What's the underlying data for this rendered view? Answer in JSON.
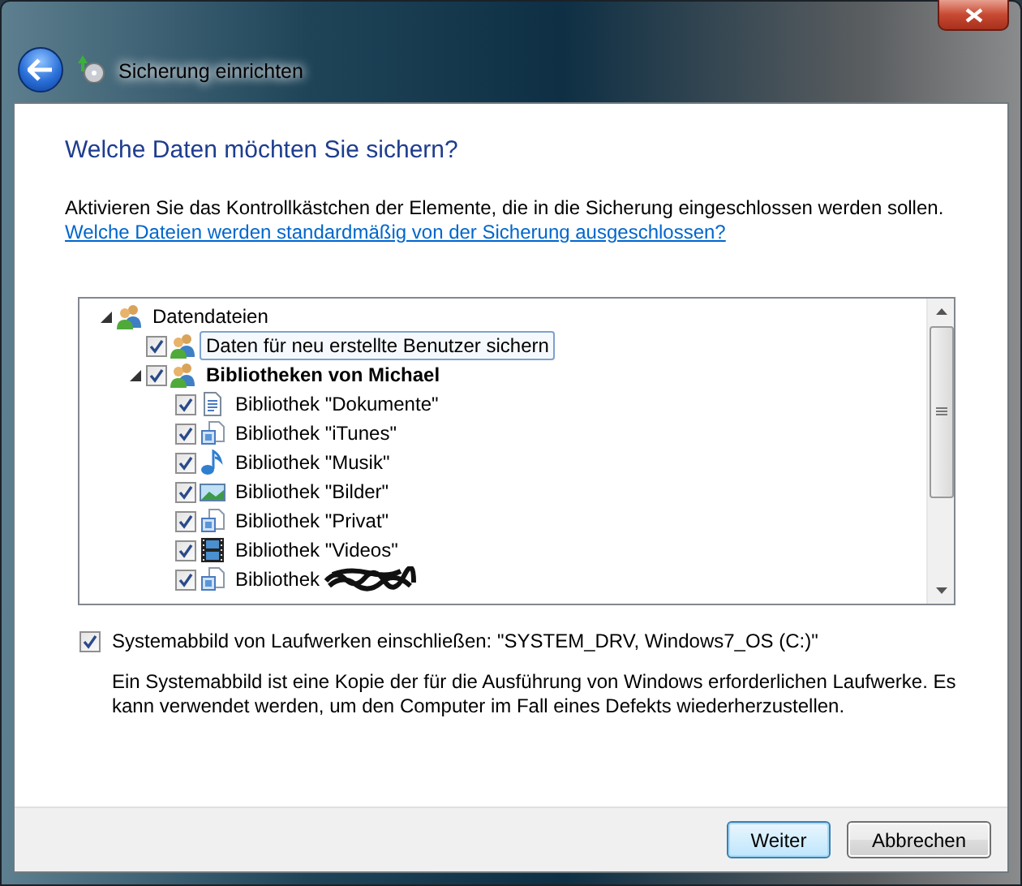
{
  "window": {
    "title": "Sicherung einrichten"
  },
  "heading": "Welche Daten möchten Sie sichern?",
  "instruction": "Aktivieren Sie das Kontrollkästchen der Elemente, die in die Sicherung eingeschlossen werden sollen.",
  "link": "Welche Dateien werden standardmäßig von der Sicherung ausgeschlossen?",
  "tree": [
    {
      "label": "Datendateien",
      "kind": "users",
      "expanded": true,
      "children": [
        {
          "label": "Daten für neu erstellte Benutzer sichern",
          "kind": "users",
          "checked": true,
          "selected": true,
          "bold": false
        },
        {
          "label": "Bibliotheken von Michael",
          "kind": "users",
          "checked": true,
          "selected": false,
          "bold": true,
          "expanded": true,
          "children": [
            {
              "label": "Bibliothek \"Dokumente\"",
              "kind": "document",
              "checked": true,
              "selected": false,
              "bold": false
            },
            {
              "label": "Bibliothek \"iTunes\"",
              "kind": "library",
              "checked": true,
              "selected": false,
              "bold": false
            },
            {
              "label": "Bibliothek \"Musik\"",
              "kind": "music",
              "checked": true,
              "selected": false,
              "bold": false
            },
            {
              "label": "Bibliothek \"Bilder\"",
              "kind": "pictures",
              "checked": true,
              "selected": false,
              "bold": false
            },
            {
              "label": "Bibliothek \"Privat\"",
              "kind": "library",
              "checked": true,
              "selected": false,
              "bold": false
            },
            {
              "label": "Bibliothek \"Videos\"",
              "kind": "videos",
              "checked": true,
              "selected": false,
              "bold": false
            },
            {
              "label": "Bibliothek",
              "kind": "library",
              "checked": true,
              "selected": false,
              "bold": false,
              "redacted": true
            }
          ]
        }
      ]
    }
  ],
  "system_image": {
    "label": "Systemabbild von Laufwerken einschließen: \"SYSTEM_DRV, Windows7_OS (C:)\"",
    "checked": true,
    "description": "Ein Systemabbild ist eine Kopie der für die Ausführung von Windows erforderlichen Laufwerke. Es kann verwendet werden, um den Computer im Fall eines Defekts wiederherzustellen."
  },
  "buttons": [
    {
      "label": "Weiter",
      "default": true
    },
    {
      "label": "Abbrechen",
      "default": false
    }
  ]
}
